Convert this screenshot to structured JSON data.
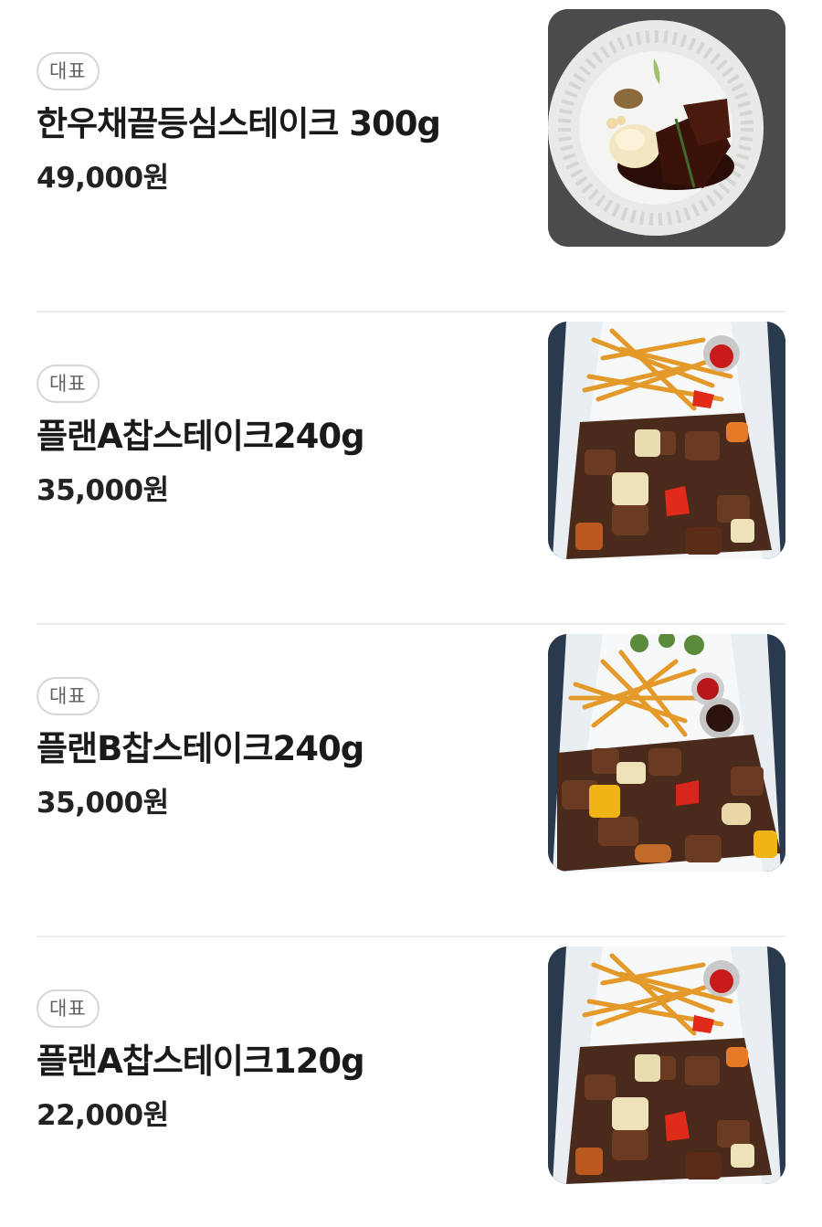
{
  "menu": {
    "items": [
      {
        "badge": "대표",
        "name": "한우채끝등심스테이크 300g",
        "price": "49,000원",
        "photo": "steak-plate"
      },
      {
        "badge": "대표",
        "name": "플랜A찹스테이크240g",
        "price": "35,000원",
        "photo": "chop-steak"
      },
      {
        "badge": "대표",
        "name": "플랜B찹스테이크240g",
        "price": "35,000원",
        "photo": "chop-steak"
      },
      {
        "badge": "대표",
        "name": "플랜A찹스테이크120g",
        "price": "22,000원",
        "photo": "chop-steak"
      }
    ]
  }
}
